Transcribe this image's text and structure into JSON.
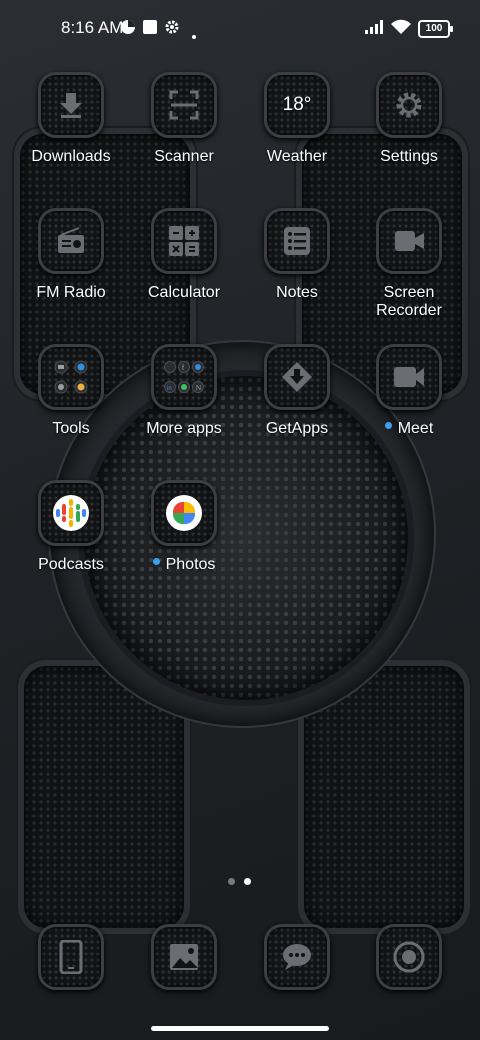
{
  "status_bar": {
    "time": "8:16 AM",
    "battery": "100"
  },
  "apps": [
    {
      "label": "Downloads",
      "icon": "download-icon"
    },
    {
      "label": "Scanner",
      "icon": "scanner-icon"
    },
    {
      "label": "Weather",
      "icon": "weather-icon",
      "temp": "18°"
    },
    {
      "label": "Settings",
      "icon": "gear-icon"
    },
    {
      "label": "FM Radio",
      "icon": "radio-icon"
    },
    {
      "label": "Calculator",
      "icon": "calculator-icon"
    },
    {
      "label": "Notes",
      "icon": "notes-icon"
    },
    {
      "label": "Screen Recorder",
      "label_line1": "Screen",
      "label_line2": "Recorder",
      "icon": "screen-recorder-icon"
    },
    {
      "label": "Tools",
      "icon": "folder-icon"
    },
    {
      "label": "More apps",
      "icon": "folder-icon"
    },
    {
      "label": "GetApps",
      "icon": "getapps-icon"
    },
    {
      "label": "Meet",
      "icon": "video-camera-icon"
    },
    {
      "label": "Podcasts",
      "icon": "podcasts-icon"
    },
    {
      "label": "Photos",
      "icon": "photos-pinwheel-icon"
    }
  ],
  "dock": [
    {
      "name": "Phone",
      "icon": "phone-icon"
    },
    {
      "name": "Gallery",
      "icon": "gallery-icon"
    },
    {
      "name": "Messages",
      "icon": "message-bubble-icon"
    },
    {
      "name": "Camera",
      "icon": "camera-icon"
    }
  ],
  "pager": {
    "pages": 2,
    "current": 2
  },
  "colors": {
    "accent_dot": "#3aa0f0",
    "icon_border": "#3b3e43"
  }
}
